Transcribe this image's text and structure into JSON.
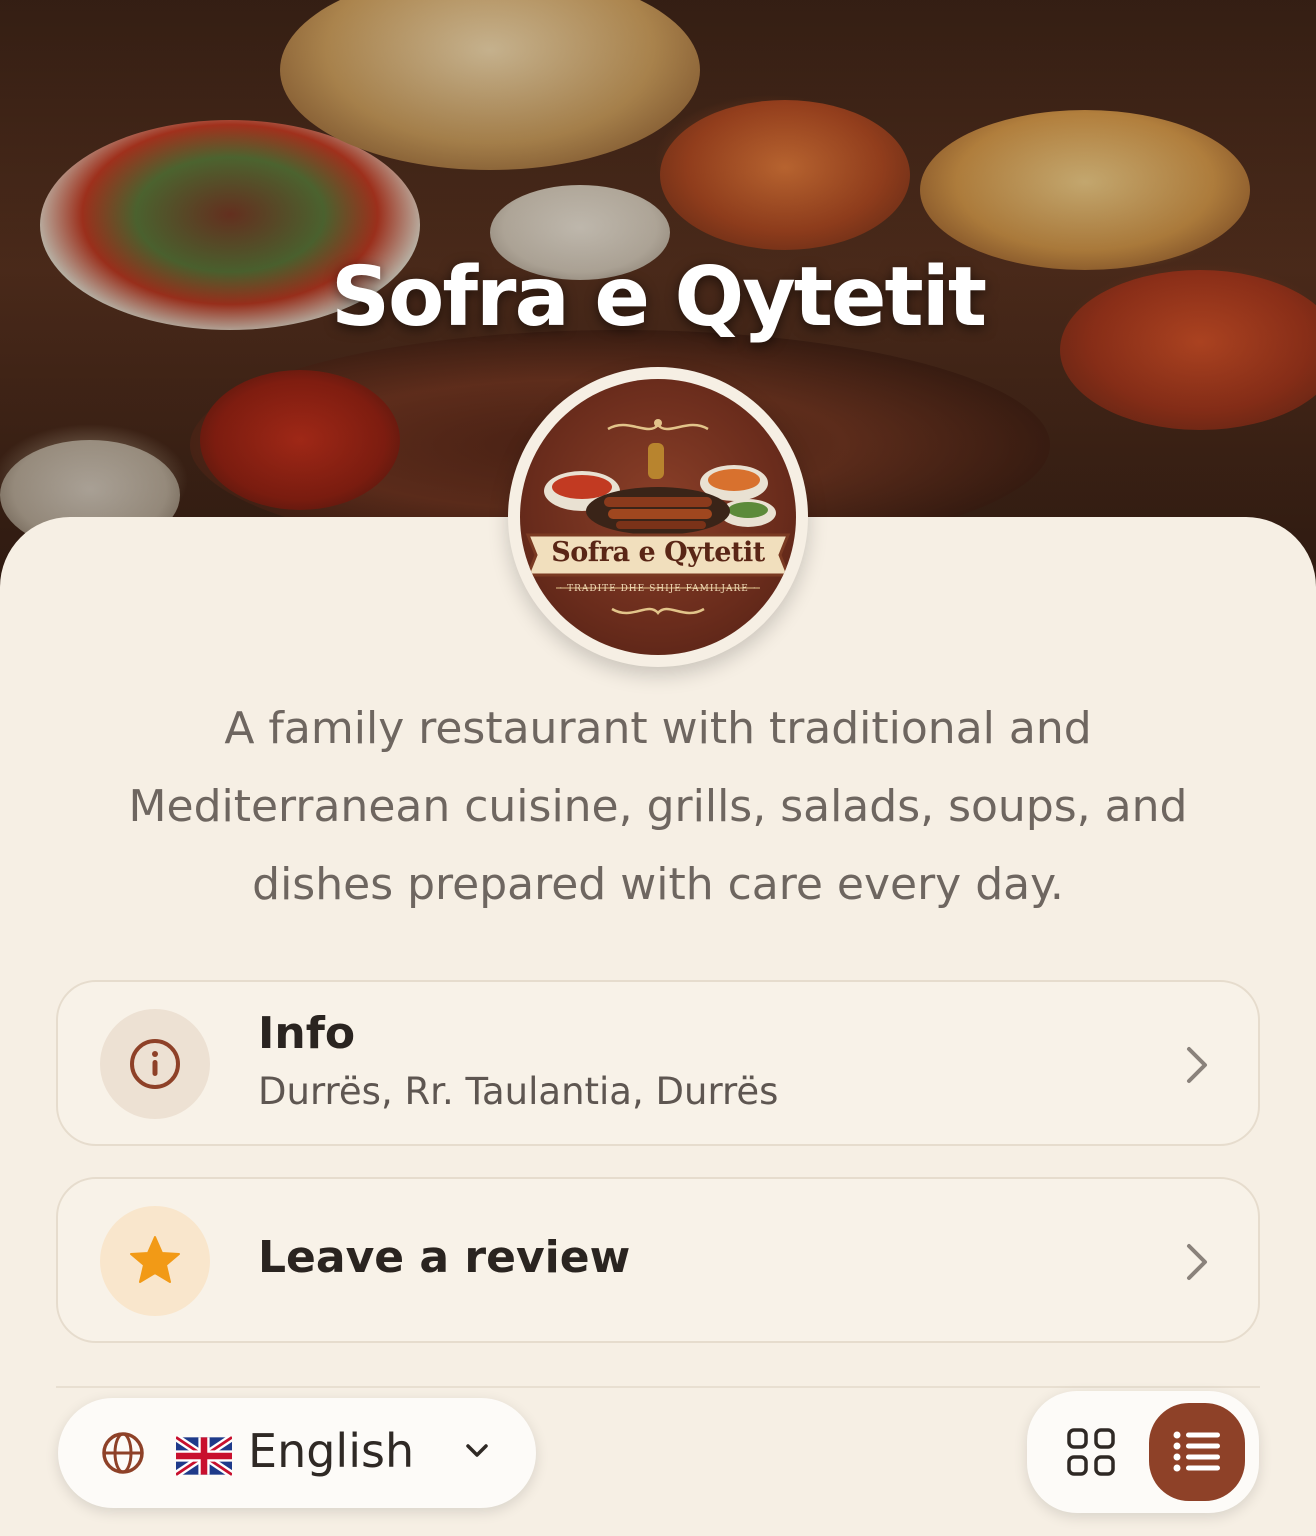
{
  "hero": {
    "title": "Sofra e Qytetit"
  },
  "logo": {
    "name": "Sofra e Qytetit",
    "tagline": "· TRADITE DHE SHIJE FAMILJARE ·"
  },
  "description": "A family restaurant with traditional and Mediterranean cuisine, grills, salads, soups, and dishes prepared with care every day.",
  "rows": {
    "info": {
      "icon": "info-icon",
      "title": "Info",
      "subtitle": "Durrës, Rr. Taulantia, Durrës"
    },
    "review": {
      "icon": "star-icon",
      "title": "Leave a review"
    }
  },
  "language": {
    "icon": "globe-icon",
    "flag": "uk-flag",
    "label": "English"
  },
  "view_toggle": {
    "options": [
      "grid",
      "list"
    ],
    "selected": "list"
  },
  "colors": {
    "background": "#f6efe4",
    "accent": "#8e4128",
    "star": "#f29a16",
    "text_primary": "#2a2420",
    "text_secondary": "#6e6660"
  }
}
